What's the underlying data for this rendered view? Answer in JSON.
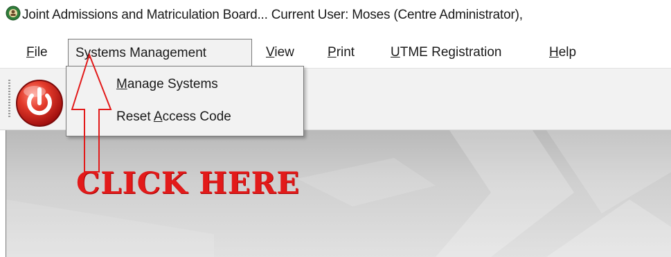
{
  "window": {
    "title": "Joint Admissions and Matriculation Board... Current User: Moses (Centre Administrator),"
  },
  "menu": {
    "items": [
      {
        "label": "File",
        "mnemonic_first": "F",
        "rest": "ile"
      },
      {
        "label": "Systems Management",
        "pre": "S",
        "mnemonic": "y",
        "rest": "stems Management"
      },
      {
        "label": "View",
        "mnemonic_first": "V",
        "rest": "iew"
      },
      {
        "label": "Print",
        "mnemonic_first": "P",
        "rest": "rint"
      },
      {
        "label": "UTME Registration",
        "mnemonic_first": "U",
        "rest": "TME Registration"
      },
      {
        "label": "Help",
        "mnemonic_first": "H",
        "rest": "elp"
      }
    ]
  },
  "dropdown": {
    "items": [
      {
        "label": "Manage Systems",
        "mnemonic_first": "M",
        "rest": "anage Systems"
      },
      {
        "label": "Reset Access Code",
        "pre": "Reset ",
        "mnemonic": "A",
        "rest": "ccess Code"
      }
    ]
  },
  "toolbar": {
    "power_icon": "power-icon"
  },
  "annotation": {
    "text": "CLICK HERE"
  },
  "colors": {
    "annotation": "#e21a1a",
    "power": "#d81e1e",
    "menu_background": "#f2f2f2"
  }
}
